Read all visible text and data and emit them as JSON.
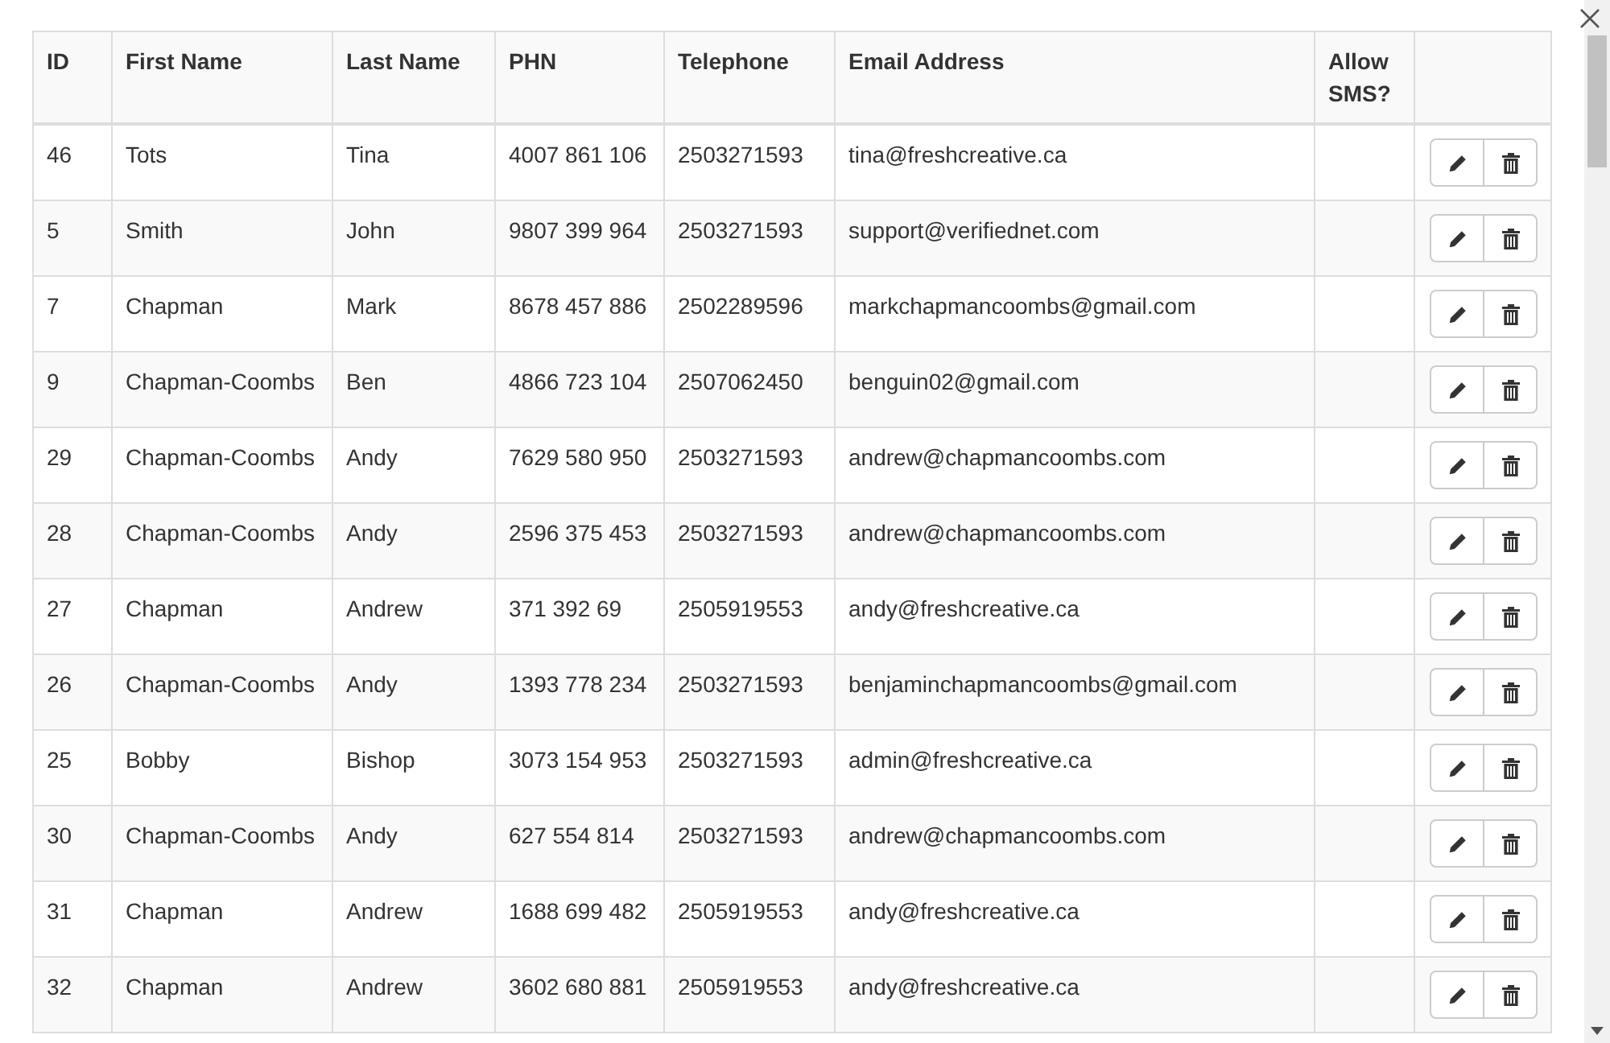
{
  "table": {
    "columns": [
      "ID",
      "First Name",
      "Last Name",
      "PHN",
      "Telephone",
      "Email Address",
      "Allow SMS?"
    ],
    "rows": [
      {
        "id": "46",
        "first_name": "Tots",
        "last_name": "Tina",
        "phn": "4007 861 106",
        "telephone": "2503271593",
        "email": "tina@freshcreative.ca"
      },
      {
        "id": "5",
        "first_name": "Smith",
        "last_name": "John",
        "phn": "9807 399 964",
        "telephone": "2503271593",
        "email": "support@verifiednet.com"
      },
      {
        "id": "7",
        "first_name": "Chapman",
        "last_name": "Mark",
        "phn": "8678 457 886",
        "telephone": "2502289596",
        "email": "markchapmancoombs@gmail.com"
      },
      {
        "id": "9",
        "first_name": "Chapman-Coombs",
        "last_name": "Ben",
        "phn": "4866 723 104",
        "telephone": "2507062450",
        "email": "benguin02@gmail.com"
      },
      {
        "id": "29",
        "first_name": "Chapman-Coombs",
        "last_name": "Andy",
        "phn": "7629 580 950",
        "telephone": "2503271593",
        "email": "andrew@chapmancoombs.com"
      },
      {
        "id": "28",
        "first_name": "Chapman-Coombs",
        "last_name": "Andy",
        "phn": "2596 375 453",
        "telephone": "2503271593",
        "email": "andrew@chapmancoombs.com"
      },
      {
        "id": "27",
        "first_name": "Chapman",
        "last_name": "Andrew",
        "phn": "371 392 69",
        "telephone": "2505919553",
        "email": "andy@freshcreative.ca"
      },
      {
        "id": "26",
        "first_name": "Chapman-Coombs",
        "last_name": "Andy",
        "phn": "1393 778 234",
        "telephone": "2503271593",
        "email": "benjaminchapmancoombs@gmail.com"
      },
      {
        "id": "25",
        "first_name": "Bobby",
        "last_name": "Bishop",
        "phn": "3073 154 953",
        "telephone": "2503271593",
        "email": "admin@freshcreative.ca"
      },
      {
        "id": "30",
        "first_name": "Chapman-Coombs",
        "last_name": "Andy",
        "phn": "627 554 814",
        "telephone": "2503271593",
        "email": "andrew@chapmancoombs.com"
      },
      {
        "id": "31",
        "first_name": "Chapman",
        "last_name": "Andrew",
        "phn": "1688 699 482",
        "telephone": "2505919553",
        "email": "andy@freshcreative.ca"
      },
      {
        "id": "32",
        "first_name": "Chapman",
        "last_name": "Andrew",
        "phn": "3602 680 881",
        "telephone": "2505919553",
        "email": "andy@freshcreative.ca"
      }
    ]
  }
}
